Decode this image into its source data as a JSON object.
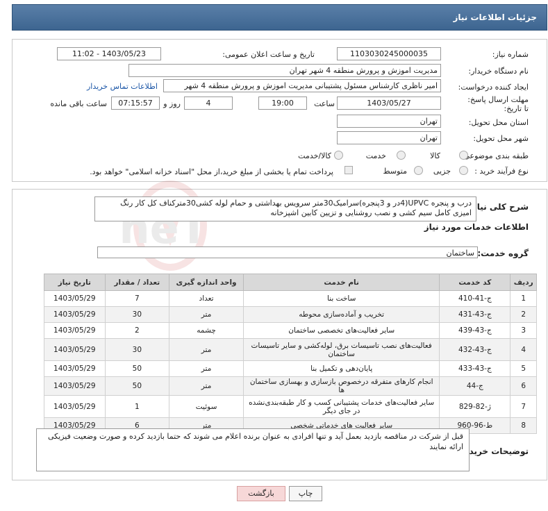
{
  "header": {
    "title": "جزئیات اطلاعات نیاز"
  },
  "form": {
    "need_number_label": "شماره نیاز:",
    "need_number": "1103030245000035",
    "announce_label": "تاریخ و ساعت اعلان عمومی:",
    "announce_value": "1403/05/23 - 11:02",
    "buyer_org_label": "نام دستگاه خریدار:",
    "buyer_org": "مدیریت اموزش و پرورش منطقه 4 شهر تهران",
    "creator_label": "ایجاد کننده درخواست:",
    "creator": "امیر ناظری کارشناس مسئول پشتیبانی  مدیریت اموزش و پرورش منطقه 4 شهر",
    "contact_link": "اطلاعات تماس خریدار",
    "deadline_label": "مهلت ارسال پاسخ: تا تاریخ:",
    "deadline_date": "1403/05/27",
    "time_label": "ساعت",
    "deadline_time": "19:00",
    "days_value": "4",
    "days_label": "روز و",
    "remaining_time": "07:15:57",
    "remaining_label": "ساعت باقی مانده",
    "province_label": "استان محل تحویل:",
    "province": "تهران",
    "city_label": "شهر محل تحویل:",
    "city": "تهران",
    "category_label": "طبقه بندی موضوعی:",
    "category_options": [
      "کالا",
      "خدمت",
      "کالا/خدمت"
    ],
    "process_label": "نوع فرآیند خرید :",
    "process_options": [
      "جزیی",
      "متوسط"
    ],
    "payment_note": "پرداخت تمام یا بخشی از مبلغ خرید،از محل \"اسناد خزانه اسلامی\" خواهد بود."
  },
  "summary": {
    "label": "شرح کلی نیاز:",
    "text": "درب و پنجره UPVC(4در و 3پنجره)سرامیک30متر سرویس بهداشتی و حمام لوله کشی30مترکناف کل کار رنگ امیزی کامل سیم کشی و نصب روشنایی و تزیین کابین اشپزخانه",
    "services_title": "اطلاعات خدمات مورد نیاز",
    "group_label": "گروه خدمت:",
    "group_value": "ساختمان"
  },
  "table": {
    "headers": [
      "ردیف",
      "کد خدمت",
      "نام خدمت",
      "واحد اندازه گیری",
      "تعداد / مقدار",
      "تاریخ نیاز"
    ],
    "rows": [
      [
        "1",
        "ج-41-410",
        "ساخت بنا",
        "تعداد",
        "7",
        "1403/05/29"
      ],
      [
        "2",
        "ج-43-431",
        "تخریب و آماده‌سازی محوطه",
        "متر",
        "30",
        "1403/05/29"
      ],
      [
        "3",
        "ج-43-439",
        "سایر فعالیت‌های تخصصی ساختمان",
        "چشمه",
        "2",
        "1403/05/29"
      ],
      [
        "4",
        "ج-43-432",
        "فعالیت‌های نصب تاسیسات برق، لوله‌کشی و سایر تاسیسات ساختمان",
        "متر",
        "30",
        "1403/05/29"
      ],
      [
        "5",
        "ج-43-433",
        "پایان‌دهی و تکمیل بنا",
        "متر",
        "50",
        "1403/05/29"
      ],
      [
        "6",
        "ج-44",
        "انجام کارهای متفرقه درخصوص بازسازی و بهسازی ساختمان ها",
        "متر",
        "50",
        "1403/05/29"
      ],
      [
        "7",
        "ژ-82-829",
        "سایر فعالیت‌های خدمات پشتیبانی کسب و کار طبقه‌بندی‌نشده در جای دیگر",
        "سوئیت",
        "1",
        "1403/05/29"
      ],
      [
        "8",
        "ط-96-960",
        "سایر فعالیت های خدماتی شخصی",
        "متر",
        "6",
        "1403/05/29"
      ]
    ]
  },
  "buyer_notes": {
    "label": "توضیحات خریدار:",
    "text": "قبل از شرکت در مناقصه بازدید بعمل آید و تنها افرادی به عنوان برنده اعلام می شوند که حتما بازدید کرده و صورت وضعیت فیزیکی ارائه نمایند"
  },
  "buttons": {
    "print": "چاپ",
    "back": "بازگشت"
  },
  "watermark": "AriaTender.neT"
}
